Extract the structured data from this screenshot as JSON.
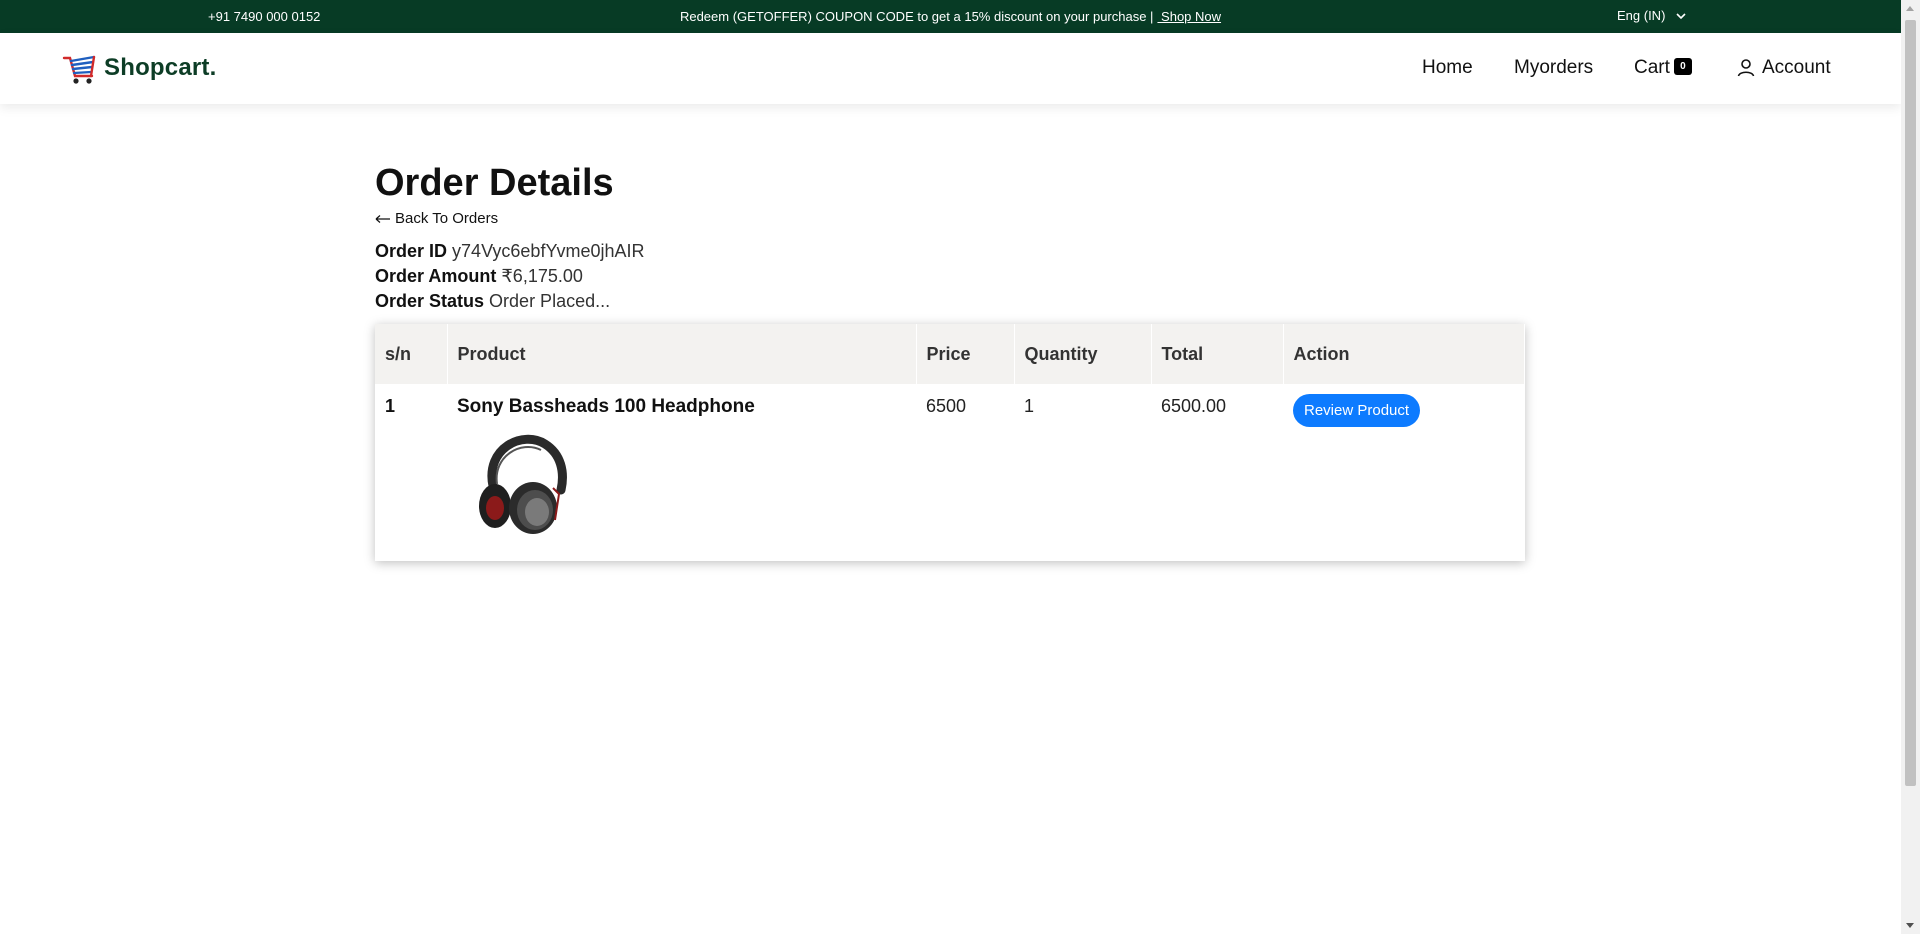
{
  "topbar": {
    "phone": "+91 7490 000 0152",
    "promo_text": "Redeem (GETOFFER) COUPON CODE to get a 15% discount on your purchase  |",
    "shop_now": " Shop Now",
    "language": "Eng (IN)",
    "background": "#073b25"
  },
  "header": {
    "brand": "Shopcart.",
    "nav": {
      "home": "Home",
      "orders": "Myorders",
      "cart": "Cart",
      "cart_count": "0",
      "account": "Account"
    }
  },
  "page": {
    "title": "Order Details",
    "back_label": "Back To Orders",
    "order_id_label": "Order ID",
    "order_id": "y74Vyc6ebfYvme0jhAIR",
    "order_amount_label": "Order Amount",
    "order_amount": "₹6,175.00",
    "order_status_label": "Order Status",
    "order_status": "Order Placed..."
  },
  "table": {
    "headers": [
      "s/n",
      "Product",
      "Price",
      "Quantity",
      "Total",
      "Action"
    ],
    "rows": [
      {
        "sn": "1",
        "product": "Sony Bassheads 100 Headphone",
        "price": "6500",
        "quantity": "1",
        "total": "6500.00",
        "action": "Review Product"
      }
    ]
  },
  "colors": {
    "brand_dark_green": "#0d3d26",
    "action_blue": "#0d7bff",
    "table_header_bg": "#f3f2f0"
  }
}
